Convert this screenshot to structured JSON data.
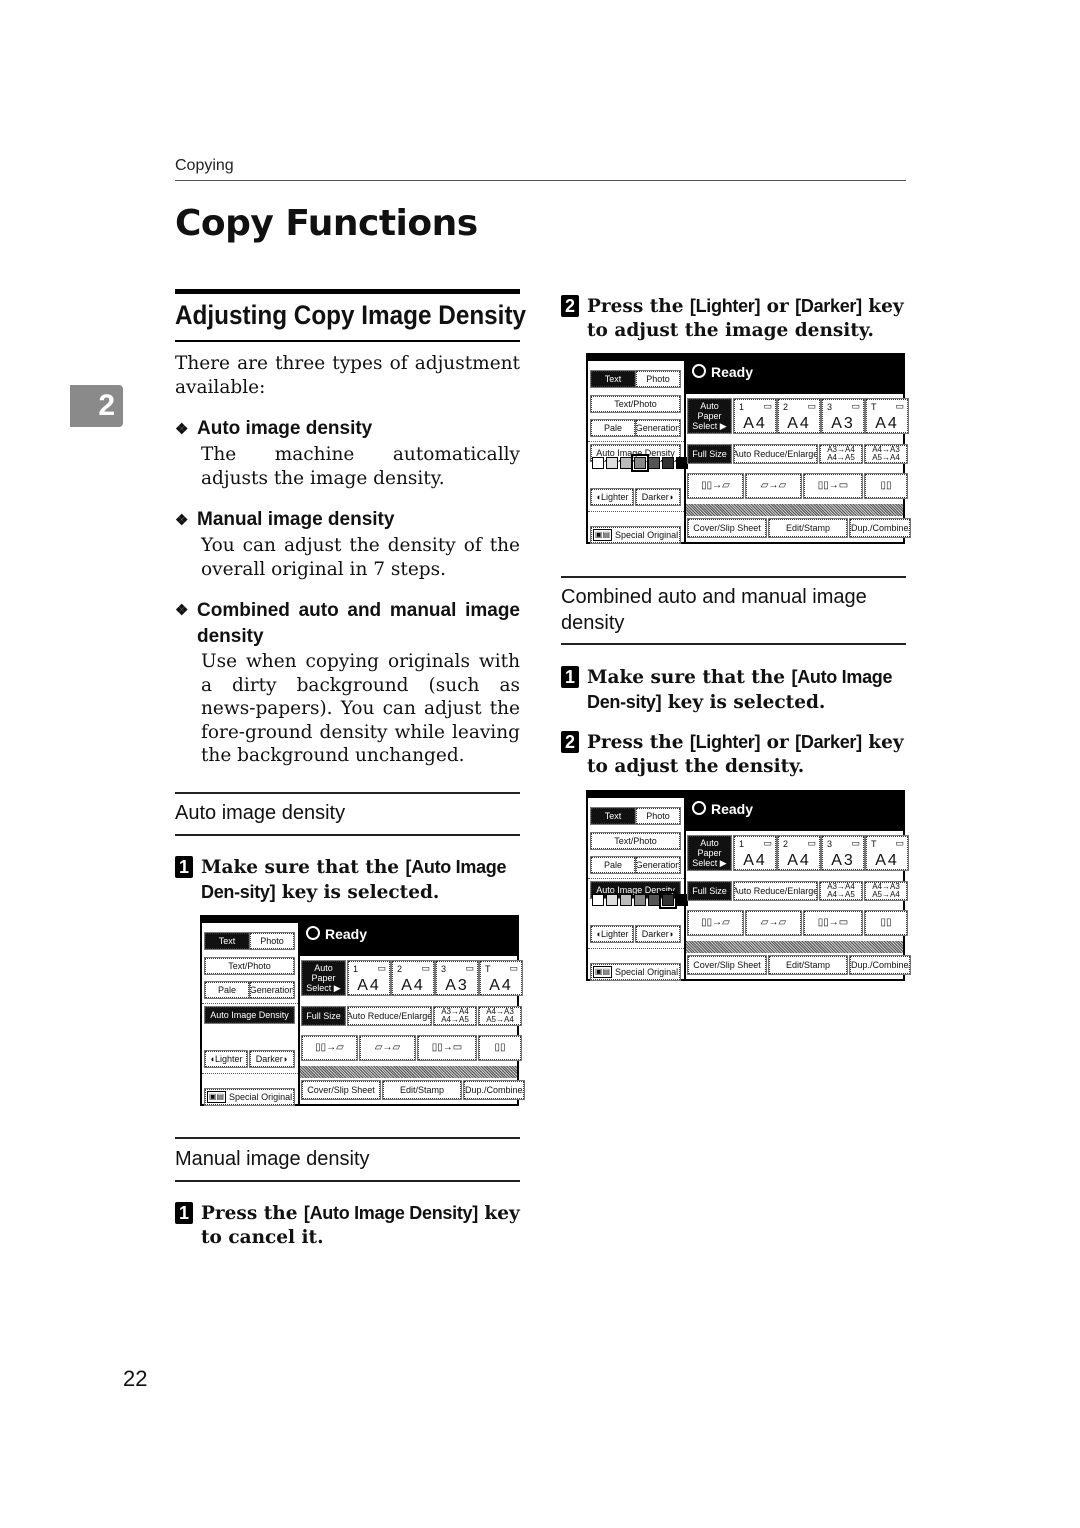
{
  "running_head": "Copying",
  "page_title": "Copy Functions",
  "chapter_tab": "2",
  "page_number": "22",
  "section": {
    "title": "Adjusting Copy Image Density",
    "intro": "There are three types of adjustment available:",
    "types": [
      {
        "heading": "Auto image density",
        "text": "The machine automatically adjusts the image density."
      },
      {
        "heading": "Manual image density",
        "text": "You can adjust the density of the overall original in 7 steps."
      },
      {
        "heading": "Combined auto and manual image density",
        "text": "Use when copying originals with a dirty background (such as news-papers). You can adjust the fore-ground density while leaving the background unchanged."
      }
    ]
  },
  "subsections": {
    "auto": {
      "title": "Auto image density",
      "steps": [
        {
          "num": "1",
          "pre": "Make sure that the ",
          "key": "[Auto Image Den-sity]",
          "post": " key is selected."
        }
      ]
    },
    "manual": {
      "title": "Manual image density",
      "steps": [
        {
          "num": "1",
          "pre": "Press the ",
          "key": "[Auto Image Density]",
          "post": " key to cancel it."
        },
        {
          "num": "2",
          "pre": "Press the ",
          "key": "[Lighter]",
          "mid": " or ",
          "key2": "[Darker]",
          "post": " key to adjust the image density."
        }
      ]
    },
    "combined": {
      "title": "Combined auto and manual image density",
      "steps": [
        {
          "num": "1",
          "pre": "Make sure that the ",
          "key": "[Auto Image Den-sity]",
          "post": " key is selected."
        },
        {
          "num": "2",
          "pre": "Press the ",
          "key": "[Lighter]",
          "mid": " or ",
          "key2": "[Darker]",
          "post": " key to adjust the density."
        }
      ]
    }
  },
  "panel": {
    "status": "Ready",
    "text": "Text",
    "photo": "Photo",
    "text_photo": "Text/Photo",
    "pale": "Pale",
    "generation": "Generation",
    "auto_image_density": "Auto Image Density",
    "lighter": "Lighter",
    "darker": "Darker",
    "special_original": "Special Original",
    "auto_paper_select": "Auto Paper Select ▶",
    "trays": [
      {
        "tray": "1",
        "size": "A4"
      },
      {
        "tray": "2",
        "size": "A4"
      },
      {
        "tray": "3",
        "size": "A3"
      },
      {
        "tray": "T",
        "size": "A4"
      }
    ],
    "full_size": "Full Size",
    "auto_reduce_enlarge": "Auto Reduce/Enlarge",
    "ratio1": "A3→A4 A4→A5",
    "ratio2": "A4→A3 A5→A4",
    "cover_slip_sheet": "Cover/Slip Sheet",
    "edit_stamp": "Edit/Stamp",
    "dup_combine": "Dup./Combine/S",
    "density_steps": 7,
    "screens": [
      {
        "auto_density_selected": true,
        "density_bar_visible": false
      },
      {
        "auto_density_selected": false,
        "density_bar_visible": true,
        "density_level": 4
      },
      {
        "auto_density_selected": true,
        "density_bar_visible": true,
        "density_level": 6
      }
    ]
  }
}
